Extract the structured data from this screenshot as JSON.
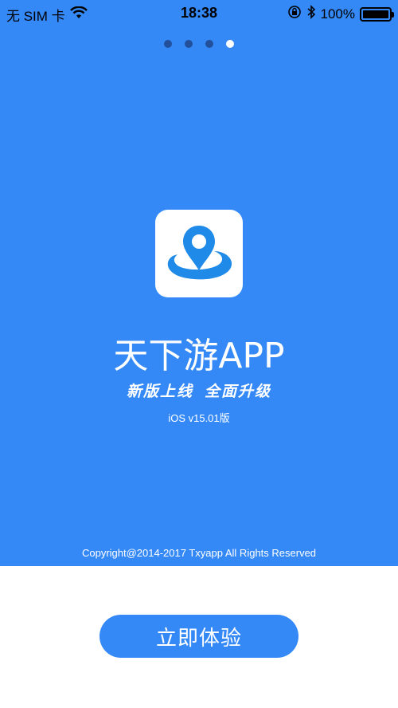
{
  "status_bar": {
    "carrier": "无 SIM 卡",
    "time": "18:38",
    "battery_percent": "100%",
    "battery_level": 1.0,
    "icons": [
      "wifi-icon",
      "orientation-lock-icon",
      "bluetooth-icon",
      "battery-icon"
    ]
  },
  "pager": {
    "count": 4,
    "active_index": 3
  },
  "app": {
    "logo_icon": "location-pin-icon",
    "title": "天下游APP",
    "slogan_part1": "新版上线",
    "slogan_part2": "全面升级",
    "version": "iOS v15.01版"
  },
  "footer": {
    "copyright": "Copyright@2014-2017 Txyapp All Rights Reserved"
  },
  "cta": {
    "label": "立即体验"
  },
  "colors": {
    "primary": "#3489f7",
    "dot_inactive": "#23509a",
    "white": "#ffffff"
  }
}
